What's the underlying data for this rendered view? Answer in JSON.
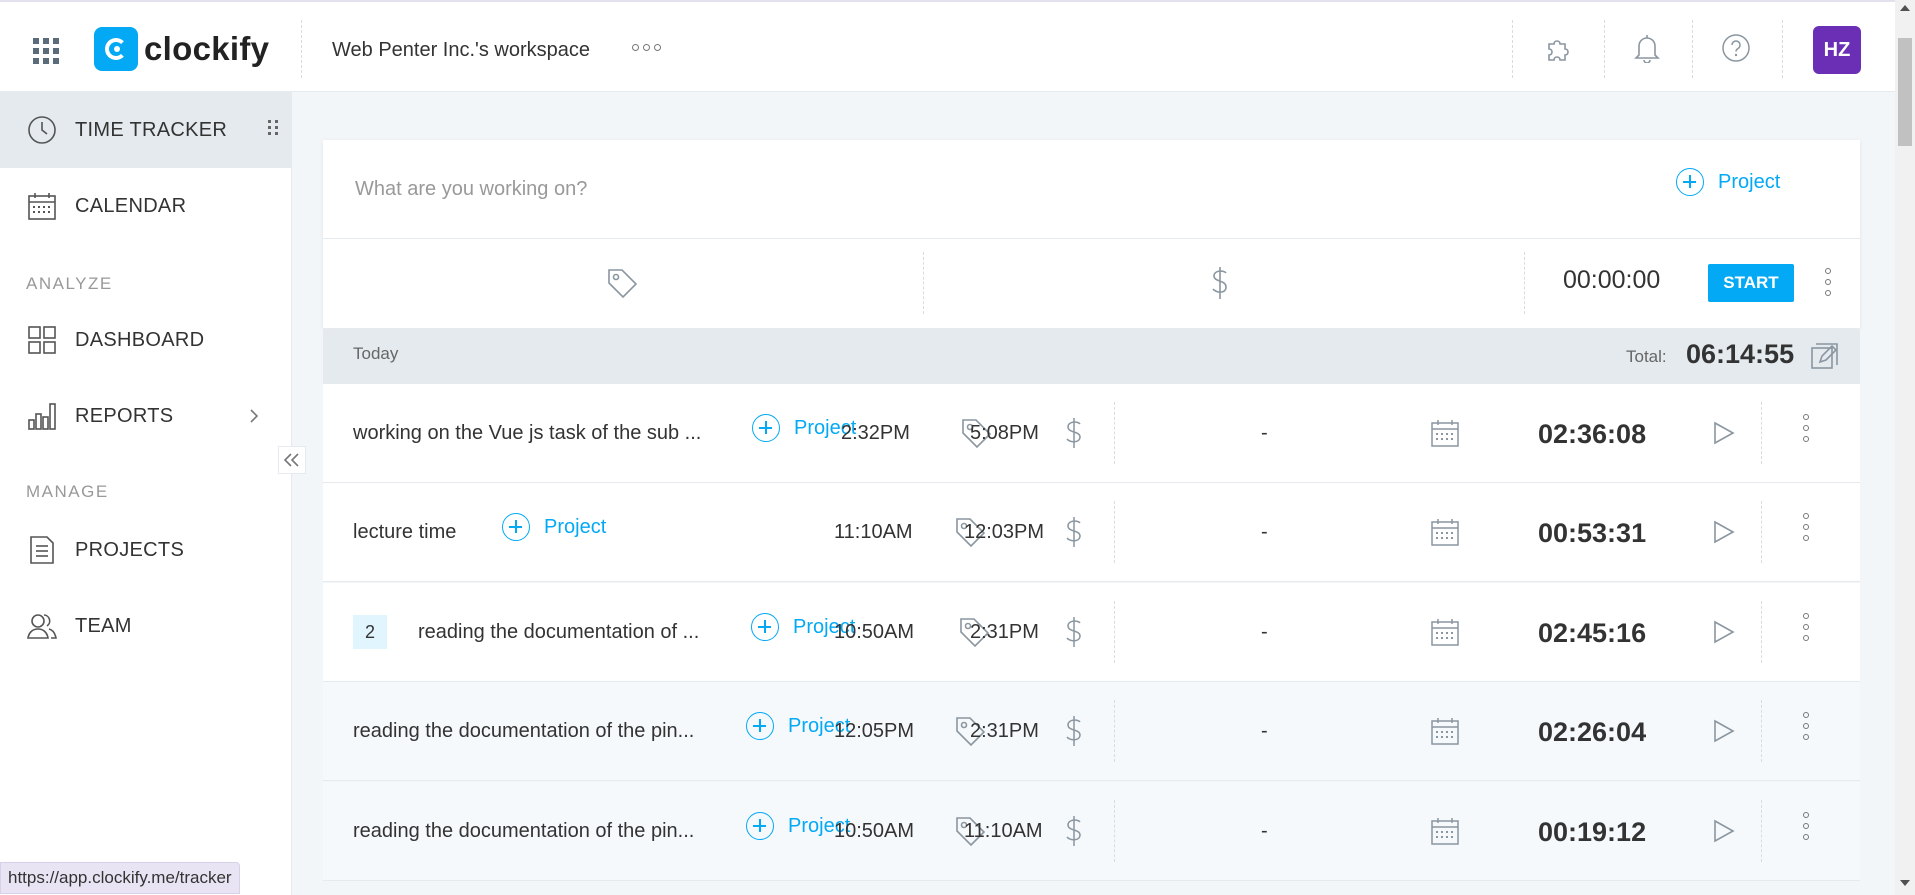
{
  "header": {
    "logo_text": "clockify",
    "workspace_name": "Web Penter Inc.'s workspace",
    "avatar_initials": "HZ",
    "icons": [
      "apps-grid-icon",
      "integrations-puzzle-icon",
      "notifications-bell-icon",
      "help-icon"
    ]
  },
  "sidebar": {
    "time_tracker": "TIME TRACKER",
    "calendar": "CALENDAR",
    "analyze_label": "ANALYZE",
    "dashboard": "DASHBOARD",
    "reports": "REPORTS",
    "manage_label": "MANAGE",
    "projects": "PROJECTS",
    "team": "TEAM"
  },
  "tracker": {
    "placeholder": "What are you working on?",
    "project_label": "Project",
    "timer": "00:00:00",
    "start_label": "START"
  },
  "day": {
    "label": "Today",
    "total_label": "Total:",
    "total_value": "06:14:55"
  },
  "entries": [
    {
      "description": "working on the Vue js task of the sub ...",
      "project": "Project",
      "start": "2:32PM",
      "sep": "-",
      "end": "5:08PM",
      "duration": "02:36:08"
    },
    {
      "description": "lecture time",
      "project": "Project",
      "start": "11:10AM",
      "sep": "-",
      "end": "12:03PM",
      "duration": "00:53:31"
    },
    {
      "group_count": "2",
      "description": "reading the documentation of ...",
      "project": "Project",
      "start": "10:50AM",
      "sep": "-",
      "end": "2:31PM",
      "duration": "02:45:16"
    },
    {
      "description": "reading the documentation of the pin...",
      "project": "Project",
      "start": "12:05PM",
      "sep": "-",
      "end": "2:31PM",
      "duration": "02:26:04"
    },
    {
      "description": "reading the documentation of the pin...",
      "project": "Project",
      "start": "10:50AM",
      "sep": "-",
      "end": "11:10AM",
      "duration": "00:19:12"
    }
  ],
  "statusbar": {
    "url": "https://app.clockify.me/tracker"
  },
  "colors": {
    "accent": "#03a9f4",
    "avatar": "#6a2fb5",
    "sidebar_active": "#e4eaee"
  }
}
